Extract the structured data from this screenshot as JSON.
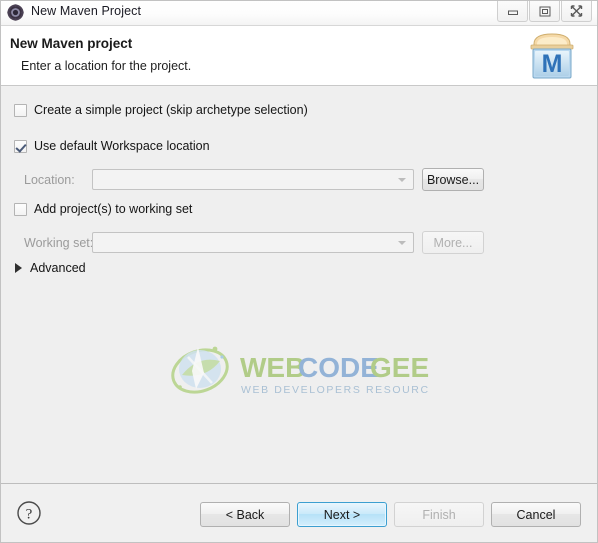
{
  "window": {
    "title": "New Maven Project",
    "icon": "maven-gear-icon",
    "controls": [
      {
        "name": "minimize",
        "glyph": "minimize-icon"
      },
      {
        "name": "maximize",
        "glyph": "maximize-icon"
      },
      {
        "name": "close",
        "glyph": "close-icon"
      }
    ]
  },
  "banner": {
    "title": "New Maven project",
    "subtitle": "Enter a location for the project.",
    "logo_letter": "M",
    "logo_name": "maven-project-icon"
  },
  "form": {
    "simple_project": {
      "label": "Create a simple project (skip archetype selection)",
      "checked": false
    },
    "default_workspace": {
      "label": "Use default Workspace location",
      "checked": true
    },
    "location": {
      "label": "Location:",
      "value": "",
      "placeholder": "",
      "disabled": true,
      "browse_label": "Browse..."
    },
    "working_set_checkbox": {
      "label": "Add project(s) to working set",
      "checked": false
    },
    "working_set": {
      "label": "Working set:",
      "value": "",
      "placeholder": "",
      "disabled": true,
      "more_label": "More..."
    },
    "advanced": {
      "label": "Advanced",
      "expanded": false
    }
  },
  "watermark": {
    "line1_part1": "WEB",
    "line1_part2": "CODE",
    "line1_part3": "GEEKS",
    "line2": "WEB DEVELOPERS RESOURCE CENTER",
    "color_green": "#8cb84a",
    "color_blue": "#5b8fc9"
  },
  "footer": {
    "help_icon": "help-icon",
    "buttons": [
      {
        "label": "< Back",
        "name": "back-button",
        "state": "enabled"
      },
      {
        "label": "Next >",
        "name": "next-button",
        "state": "default"
      },
      {
        "label": "Finish",
        "name": "finish-button",
        "state": "disabled"
      },
      {
        "label": "Cancel",
        "name": "cancel-button",
        "state": "enabled"
      }
    ]
  }
}
